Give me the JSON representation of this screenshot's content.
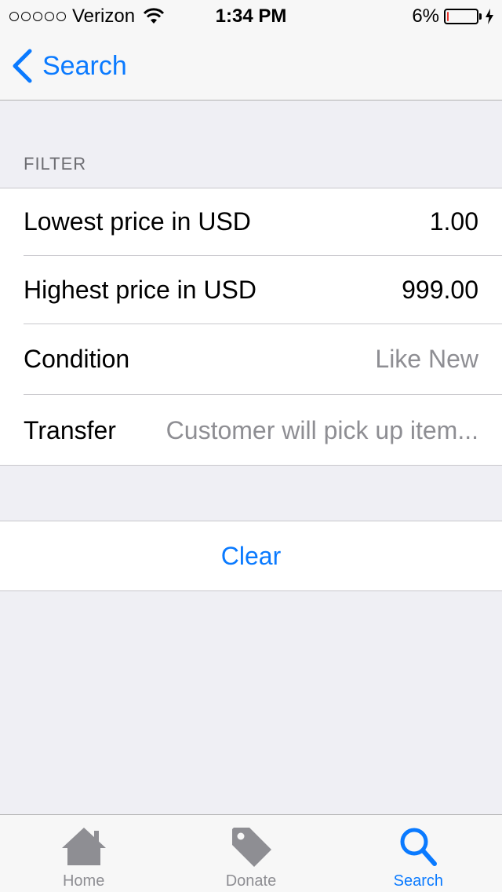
{
  "status_bar": {
    "carrier": "Verizon",
    "time": "1:34 PM",
    "battery_percent": "6%",
    "battery_level": 0.06,
    "signal_icon": "signal-dots-icon",
    "wifi_icon": "wifi-icon",
    "charging_icon": "bolt-icon"
  },
  "nav": {
    "back_label": "Search",
    "back_icon": "chevron-left-icon"
  },
  "filter": {
    "header": "FILTER",
    "rows": [
      {
        "label": "Lowest price in USD",
        "value": "1.00"
      },
      {
        "label": "Highest price in USD",
        "value": "999.00"
      },
      {
        "label": "Condition",
        "value": "Like New"
      },
      {
        "label": "Transfer",
        "value": "Customer will pick up item..."
      }
    ]
  },
  "actions": {
    "clear_label": "Clear"
  },
  "tab_bar": {
    "tabs": [
      {
        "label": "Home",
        "icon": "home-icon"
      },
      {
        "label": "Donate",
        "icon": "tag-icon"
      },
      {
        "label": "Search",
        "icon": "search-icon",
        "active": true
      }
    ]
  },
  "colors": {
    "accent": "#0a7aff",
    "background": "#efeff4",
    "muted_text": "#8e8e93",
    "battery_low": "#e8372f"
  }
}
